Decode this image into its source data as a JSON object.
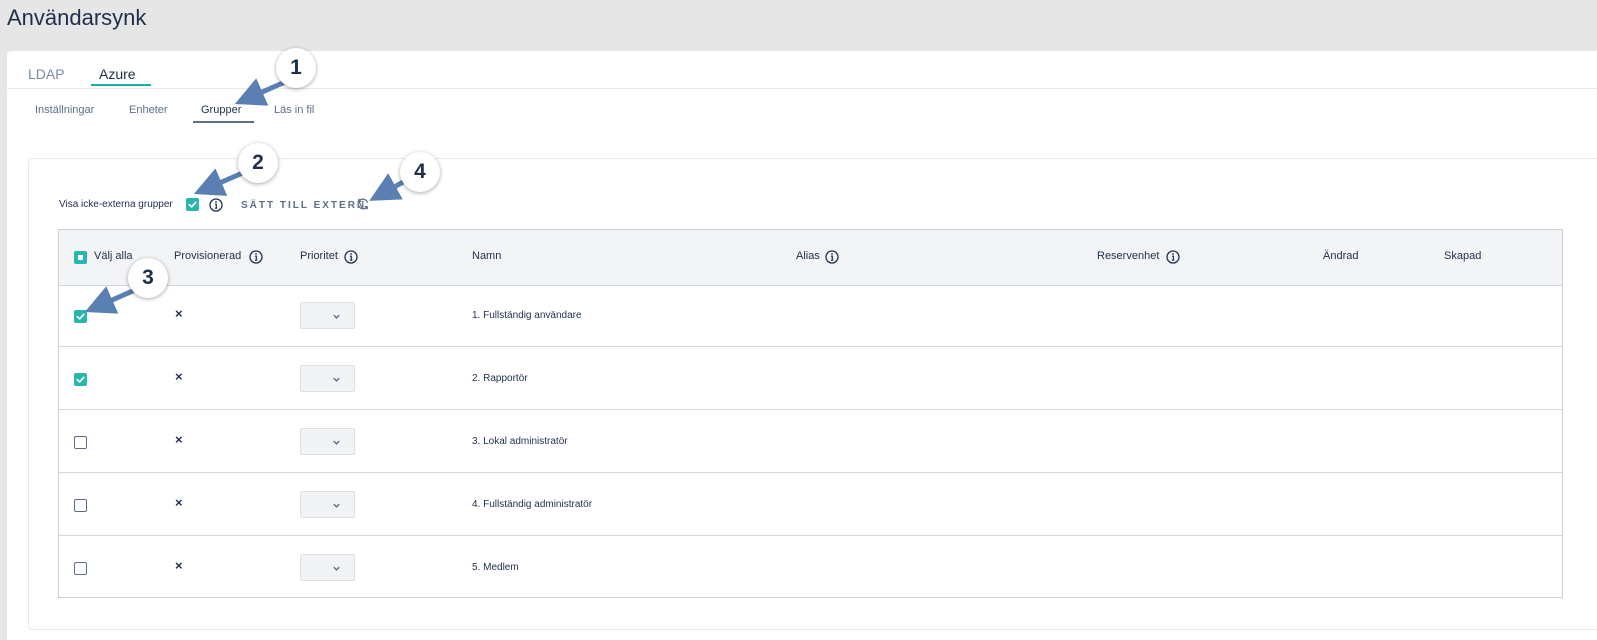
{
  "page": {
    "title": "Användarsynk"
  },
  "main_tabs": [
    {
      "label": "LDAP",
      "active": false
    },
    {
      "label": "Azure",
      "active": true
    }
  ],
  "sub_tabs": [
    {
      "label": "Inställningar",
      "active": false
    },
    {
      "label": "Enheter",
      "active": false
    },
    {
      "label": "Grupper",
      "active": true
    },
    {
      "label": "Läs in fil",
      "active": false
    }
  ],
  "toolbar": {
    "show_non_external_label": "Visa icke-externa grupper",
    "show_non_external_checked": true,
    "set_extern_label": "SÄTT TILL EXTERN"
  },
  "table": {
    "select_all_label": "Välj alla",
    "columns": [
      "Provisionerad",
      "Prioritet",
      "Namn",
      "Alias",
      "Reservenhet",
      "Ändrad",
      "Skapad"
    ],
    "rows": [
      {
        "checked": true,
        "provisioned": "×",
        "name": "1. Fullständig användare"
      },
      {
        "checked": true,
        "provisioned": "×",
        "name": "2. Rapportör"
      },
      {
        "checked": false,
        "provisioned": "×",
        "name": "3. Lokal administratör"
      },
      {
        "checked": false,
        "provisioned": "×",
        "name": "4. Fullständig administratör"
      },
      {
        "checked": false,
        "provisioned": "×",
        "name": "5. Medlem"
      }
    ]
  },
  "callouts": [
    "1",
    "2",
    "3",
    "4"
  ],
  "colors": {
    "accent": "#29b6ac",
    "text": "#1e2f4d",
    "arrow": "#5a7fb3"
  },
  "icons": [
    "info-icon",
    "refresh-icon",
    "chevron-down-icon",
    "check-icon",
    "close-icon"
  ]
}
